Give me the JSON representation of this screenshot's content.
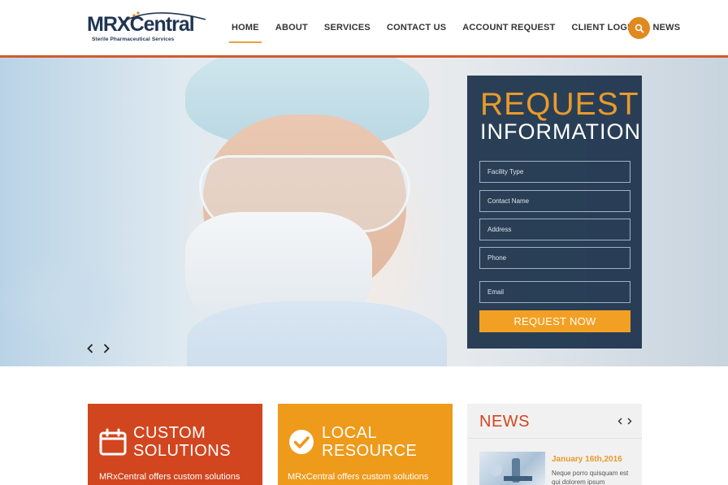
{
  "logo": {
    "text_mrx": "MRX",
    "text_central": "Central",
    "tagline": "Sterile Pharmaceutical Services"
  },
  "nav": {
    "items": [
      {
        "label": "HOME",
        "active": true
      },
      {
        "label": "ABOUT",
        "active": false
      },
      {
        "label": "SERVICES",
        "active": false
      },
      {
        "label": "CONTACT US",
        "active": false
      },
      {
        "label": "ACCOUNT REQUEST",
        "active": false
      },
      {
        "label": "CLIENT LOGIN",
        "active": false
      },
      {
        "label": "NEWS",
        "active": false
      }
    ],
    "search_icon": "search-icon"
  },
  "hero": {
    "prev_icon": "chevron-left-icon",
    "next_icon": "chevron-right-icon"
  },
  "form": {
    "title_line1": "REQUEST",
    "title_line2": "INFORMATION",
    "fields": {
      "facility_type": {
        "placeholder": "Facility Type",
        "value": ""
      },
      "contact_name": {
        "placeholder": "Contact Name",
        "value": ""
      },
      "address": {
        "placeholder": "Address",
        "value": ""
      },
      "phone": {
        "placeholder": "Phone",
        "value": ""
      },
      "email": {
        "placeholder": "Email",
        "value": ""
      }
    },
    "submit_label": "REQUEST NOW"
  },
  "boxes": {
    "custom": {
      "title_line1": "CUSTOM",
      "title_line2": "SOLUTIONS",
      "text": "MRxCentral offers custom solutions",
      "icon": "calendar-icon"
    },
    "local": {
      "title_line1": "LOCAL",
      "title_line2": "RESOURCE",
      "text": "MRxCentral offers custom solutions",
      "icon": "check-circle-icon"
    }
  },
  "news": {
    "title": "NEWS",
    "prev_icon": "chevron-left-icon",
    "next_icon": "chevron-right-icon",
    "item": {
      "date": "January 16th,2016",
      "text": "Neque porro quisquam est qui dolorem ipsum"
    }
  },
  "colors": {
    "brand_navy": "#1f3553",
    "accent_orange": "#e99a2b",
    "accent_red": "#d2461f",
    "button_orange": "#f2a023"
  }
}
